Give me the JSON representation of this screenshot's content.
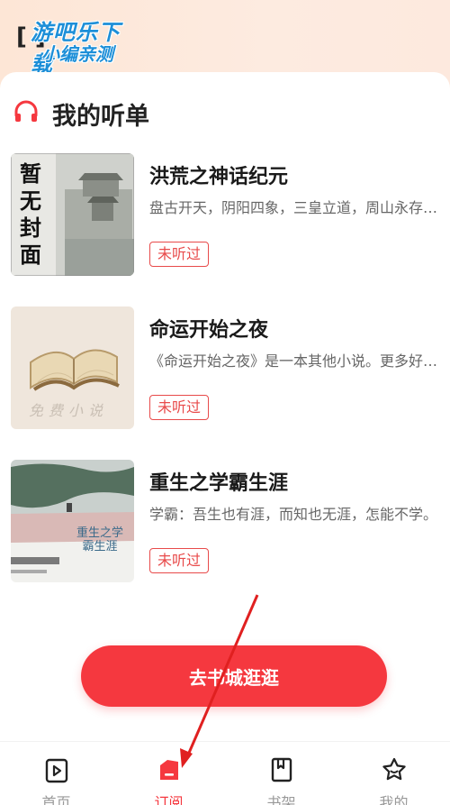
{
  "watermark": {
    "line1": "游吧乐下载",
    "line2": "小编亲测"
  },
  "section": {
    "icon": "headphones-icon",
    "title": "我的听单"
  },
  "books": [
    {
      "title": "洪荒之神话纪元",
      "desc": "盘古开天，阴阳四象，三皇立道，周山永存，人族始兴。",
      "badge": "未听过",
      "cover_text": "暂无封面"
    },
    {
      "title": "命运开始之夜",
      "desc": "《命运开始之夜》是一本其他小说。更多好书尽在本站。",
      "badge": "未听过",
      "cover_text": "免费小说"
    },
    {
      "title": "重生之学霸生涯",
      "desc": "学霸：吾生也有涯，而知也无涯，怎能不学。",
      "badge": "未听过",
      "cover_text": "重生之学霸生涯"
    }
  ],
  "cta_label": "去书城逛逛",
  "tabs": [
    {
      "label": "首页",
      "icon": "home-icon"
    },
    {
      "label": "订阅",
      "icon": "subscribe-icon"
    },
    {
      "label": "书架",
      "icon": "bookshelf-icon"
    },
    {
      "label": "我的",
      "icon": "profile-icon"
    }
  ],
  "colors": {
    "accent": "#f5383f",
    "badge": "#e84a4a"
  }
}
